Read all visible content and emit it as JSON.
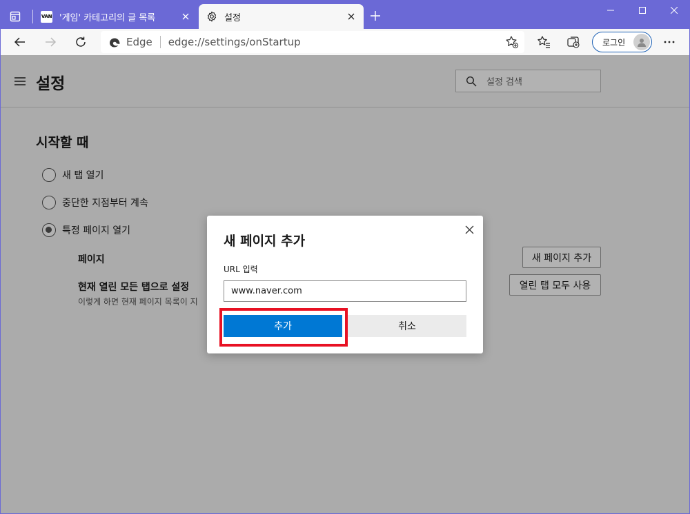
{
  "tabs": [
    {
      "title": "'게임' 카테고리의 글 목록",
      "favicon_text": "VAN",
      "active": false
    },
    {
      "title": "설정",
      "active": true
    }
  ],
  "address_bar": {
    "browser_label": "Edge",
    "url": "edge://settings/onStartup"
  },
  "profile": {
    "login_label": "로그인"
  },
  "settings": {
    "title": "설정",
    "search_placeholder": "설정 검색",
    "section_title": "시작할 때",
    "options": [
      {
        "label": "새 탭 열기",
        "checked": false
      },
      {
        "label": "중단한 지점부터 계속",
        "checked": false
      },
      {
        "label": "특정 페이지 열기",
        "checked": true
      }
    ],
    "pages_label": "페이지",
    "add_page_button": "새 페이지 추가",
    "use_open_tabs_label": "현재 열린 모든 탭으로 설정",
    "use_open_tabs_desc": "이렇게 하면 현재 페이지 목록이 지",
    "use_all_tabs_button": "열린 탭 모두 사용"
  },
  "dialog": {
    "title": "새 페이지 추가",
    "url_label": "URL 입력",
    "url_value": "www.naver.com",
    "add_button": "추가",
    "cancel_button": "취소"
  },
  "colors": {
    "titlebar": "#6b69d6",
    "primary_button": "#0078d4",
    "highlight": "#e81123"
  }
}
